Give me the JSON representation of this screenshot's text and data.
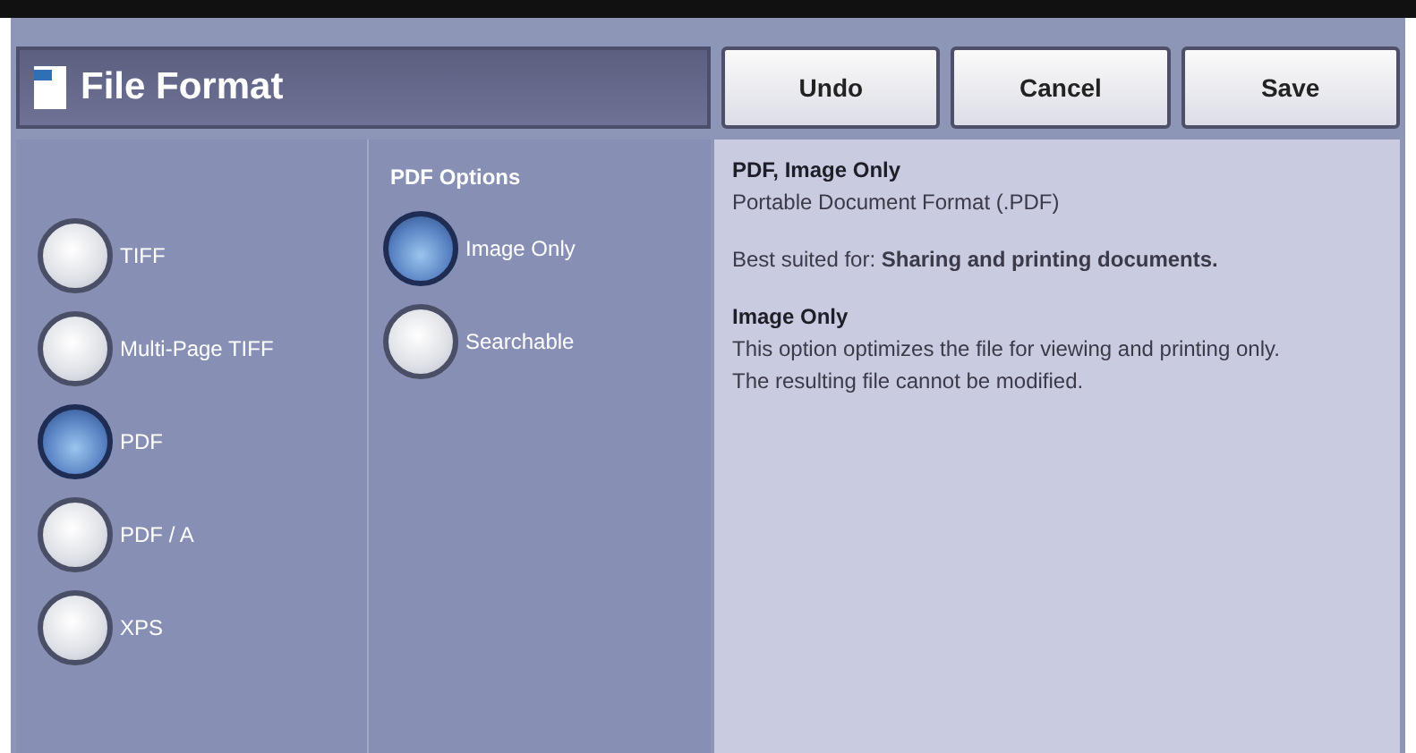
{
  "window": {
    "title": "File Format"
  },
  "buttons": [
    "Undo",
    "Cancel",
    "Save"
  ],
  "formats": [
    {
      "label": "TIFF",
      "selected": false
    },
    {
      "label": "Multi-Page TIFF",
      "selected": false
    },
    {
      "label": "PDF",
      "selected": true
    },
    {
      "label": "PDF / A",
      "selected": false
    },
    {
      "label": "XPS",
      "selected": false
    }
  ],
  "pdf_options": {
    "heading": "PDF Options",
    "items": [
      {
        "label": "Image Only",
        "selected": true
      },
      {
        "label": "Searchable",
        "selected": false
      }
    ]
  },
  "info": {
    "title": "PDF, Image Only",
    "subtitle": "Portable Document Format (.PDF)",
    "best_suited": "Best suited for: **Sharing and printing documents.**",
    "option_title": "Image Only",
    "option_text": "This option optimizes the file for viewing and printing only. The resulting file cannot be modified."
  }
}
